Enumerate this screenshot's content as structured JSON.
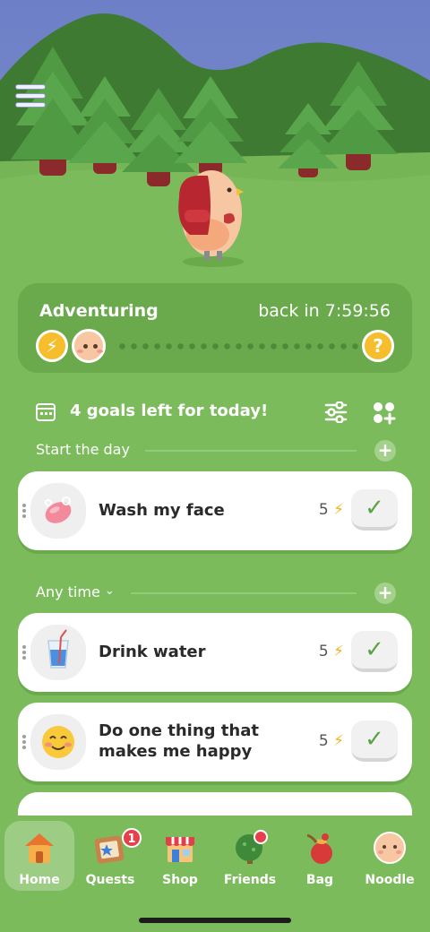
{
  "adventure": {
    "title": "Adventuring",
    "timer": "back in 7:59:56",
    "start_icon": "lightning-bolt-icon",
    "end_icon": "question-mark-icon",
    "end_symbol": "?",
    "bolt_symbol": "⚡"
  },
  "goals_header": {
    "title": "4 goals left for today!"
  },
  "sections": {
    "start_day": {
      "label": "Start the day",
      "add": "+"
    },
    "any_time": {
      "label": "Any time",
      "chevron": "⌄",
      "add": "+"
    }
  },
  "goals": [
    {
      "label": "Wash my face",
      "points": "5",
      "icon": "soap-icon",
      "check": "✓"
    },
    {
      "label": "Drink water",
      "points": "5",
      "icon": "water-glass-icon",
      "check": "✓"
    },
    {
      "label_line1": "Do one thing that",
      "label_line2": "makes me happy",
      "points": "5",
      "icon": "happy-face-icon",
      "check": "✓"
    }
  ],
  "nav": {
    "items": [
      {
        "label": "Home",
        "icon": "house-icon",
        "active": true
      },
      {
        "label": "Quests",
        "icon": "quests-board-icon",
        "badge": "1"
      },
      {
        "label": "Shop",
        "icon": "shop-icon"
      },
      {
        "label": "Friends",
        "icon": "tree-friends-icon"
      },
      {
        "label": "Bag",
        "icon": "bag-icon"
      },
      {
        "label": "Noodle",
        "icon": "noodle-face-icon"
      }
    ]
  },
  "colors": {
    "background_green": "#7cbb5b",
    "card_green": "#6aa94c",
    "accent_yellow": "#f6be2c",
    "check_green": "#5ba243"
  }
}
